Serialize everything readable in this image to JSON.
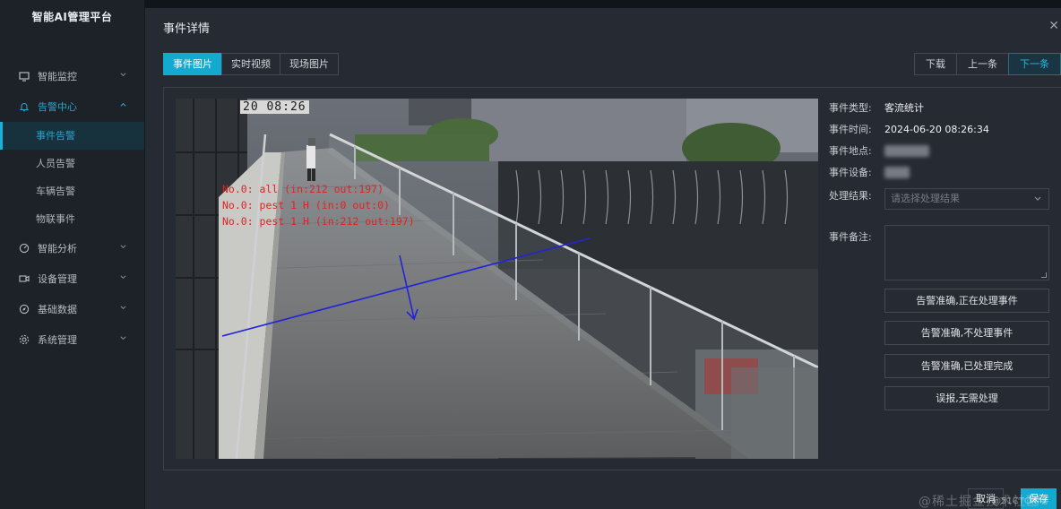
{
  "app": {
    "title": "智能AI管理平台"
  },
  "sidebar": {
    "items": [
      {
        "label": "智能监控",
        "icon": "monitor-icon",
        "expanded": false
      },
      {
        "label": "告警中心",
        "icon": "bell-icon",
        "expanded": true,
        "children": [
          "事件告警",
          "人员告警",
          "车辆告警",
          "物联事件"
        ]
      },
      {
        "label": "智能分析",
        "icon": "analysis-icon",
        "expanded": false
      },
      {
        "label": "设备管理",
        "icon": "camera-icon",
        "expanded": false
      },
      {
        "label": "基础数据",
        "icon": "compass-icon",
        "expanded": false
      },
      {
        "label": "系统管理",
        "icon": "gear-icon",
        "expanded": false
      }
    ],
    "active_sub": "事件告警"
  },
  "modal": {
    "title": "事件详情",
    "close_icon": "close-icon",
    "tabs": [
      "事件图片",
      "实时视频",
      "现场图片"
    ],
    "active_tab": "事件图片",
    "nav": {
      "download": "下载",
      "prev": "上一条",
      "next": "下一条"
    },
    "image": {
      "timestamp": "20 08:26",
      "overlay_lines": [
        "No.0: all (in:212 out:197)",
        "No.0: pest 1 H (in:0 out:0)",
        "No.0: pest 1 H (in:212 out:197)"
      ]
    },
    "details": {
      "type_label": "事件类型:",
      "type_value": "客流统计",
      "time_label": "事件时间:",
      "time_value": "2024-06-20 08:26:34",
      "place_label": "事件地点:",
      "device_label": "事件设备:",
      "result_label": "处理结果:",
      "result_placeholder": "请选择处理结果",
      "remark_label": "事件备注:",
      "remark_value": ""
    },
    "actions": [
      "告警准确,正在处理事件",
      "告警准确,不处理事件",
      "告警准确,已处理完成",
      "误报,无需处理"
    ],
    "footer": {
      "cancel": "取消",
      "save": "保存"
    }
  },
  "watermark": {
    "text": "@稀土掘金技术社区",
    "small": "@51CTO博客"
  },
  "colors": {
    "accent": "#12aacf",
    "overlay_text": "#e02323",
    "count_line": "#2323d8"
  }
}
